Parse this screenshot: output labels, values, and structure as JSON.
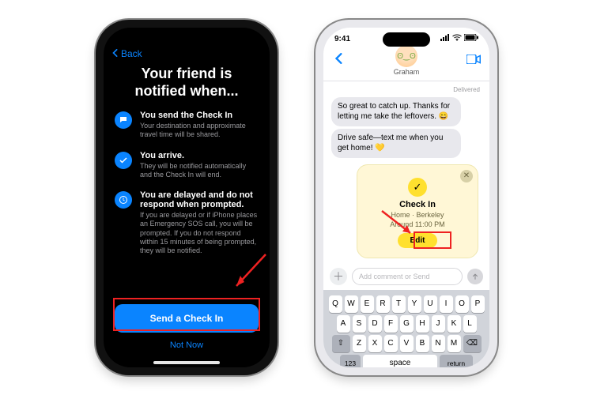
{
  "left": {
    "back": "Back",
    "title_line1": "Your friend is",
    "title_line2": "notified when...",
    "bullets": [
      {
        "icon": "chat-bubble-icon",
        "heading": "You send the Check In",
        "body": "Your destination and approximate travel time will be shared."
      },
      {
        "icon": "checkmark-icon",
        "heading": "You arrive.",
        "body": "They will be notified automatically and the Check In will end."
      },
      {
        "icon": "clock-icon",
        "heading": "You are delayed and do not respond when prompted.",
        "body": "If you are delayed or if iPhone places an Emergency SOS call, you will be prompted. If you do not respond within 15 minutes of being prompted, they will be notified."
      }
    ],
    "primary": "Send a Check In",
    "secondary": "Not Now"
  },
  "right": {
    "status": {
      "time": "9:41"
    },
    "contact": "Graham",
    "delivered": "Delivered",
    "messages": [
      "So great to catch up. Thanks for letting me take the leftovers. 😄",
      "Drive safe—text me when you get home! 💛"
    ],
    "checkin": {
      "title": "Check In",
      "sub1": "Home · Berkeley",
      "sub2": "Around 11:00 PM",
      "edit": "Edit"
    },
    "compose_placeholder": "Add comment or Send",
    "keyboard": {
      "row1": [
        "Q",
        "W",
        "E",
        "R",
        "T",
        "Y",
        "U",
        "I",
        "O",
        "P"
      ],
      "row2": [
        "A",
        "S",
        "D",
        "F",
        "G",
        "H",
        "J",
        "K",
        "L"
      ],
      "row3": [
        "Z",
        "X",
        "C",
        "V",
        "B",
        "N",
        "M"
      ],
      "n123": "123",
      "space": "space",
      "return": "return"
    }
  }
}
